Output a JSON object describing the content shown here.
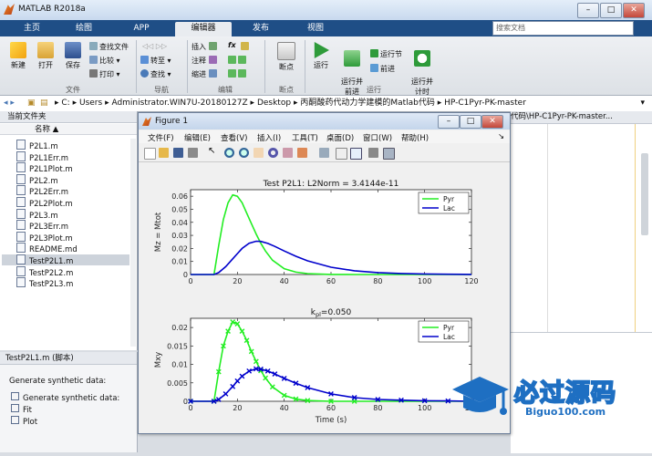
{
  "window": {
    "title": "MATLAB R2018a",
    "controls": [
      "–",
      "□",
      "✕"
    ]
  },
  "tabs": [
    {
      "label": "主页",
      "active": false
    },
    {
      "label": "绘图",
      "active": false
    },
    {
      "label": "APP",
      "active": false
    },
    {
      "label": "编辑器",
      "active": true
    },
    {
      "label": "发布",
      "active": false
    },
    {
      "label": "视图",
      "active": false
    }
  ],
  "search": {
    "placeholder": "搜索文档"
  },
  "ribbon": {
    "file": {
      "new": "新建",
      "open": "打开",
      "save": "保存",
      "find_files": "查找文件",
      "compare": "比较",
      "print": "打印",
      "group": "文件"
    },
    "nav": {
      "goto": "转至",
      "find": "查找",
      "group": "导航"
    },
    "edit": {
      "insert": "插入",
      "comment": "注释",
      "indent": "缩进",
      "fx": "fx",
      "group": "编辑"
    },
    "breakpoint": {
      "label": "断点",
      "group": "断点"
    },
    "run": {
      "run": "运行",
      "run_advance": "运行并\n前进",
      "run_section": "运行节",
      "advance": "前进",
      "run_time": "运行并\n计时",
      "group": "运行"
    }
  },
  "path": [
    "C:",
    "Users",
    "Administrator.WIN7U-20180127Z",
    "Desktop",
    "丙酮酸药代动力学建模的Matlab代码",
    "HP-C1Pyr-PK-master"
  ],
  "left_panel": {
    "title": "当前文件夹",
    "column": "名称 ▲",
    "files": [
      {
        "name": "P2L1.m",
        "selected": false
      },
      {
        "name": "P2L1Err.m",
        "selected": false
      },
      {
        "name": "P2L1Plot.m",
        "selected": false
      },
      {
        "name": "P2L2.m",
        "selected": false
      },
      {
        "name": "P2L2Err.m",
        "selected": false
      },
      {
        "name": "P2L2Plot.m",
        "selected": false
      },
      {
        "name": "P2L3.m",
        "selected": false
      },
      {
        "name": "P2L3Err.m",
        "selected": false
      },
      {
        "name": "P2L3Plot.m",
        "selected": false
      },
      {
        "name": "README.md",
        "selected": false
      },
      {
        "name": "TestP2L1.m",
        "selected": true
      },
      {
        "name": "TestP2L2.m",
        "selected": false
      },
      {
        "name": "TestP2L3.m",
        "selected": false
      }
    ]
  },
  "details": {
    "title": "TestP2L1.m  (脚本)",
    "heading": "Generate synthetic data:",
    "items": [
      "Generate synthetic data:",
      "Fit",
      "Plot"
    ]
  },
  "editor": {
    "tab_path": "代码\\HP-C1Pyr-PK-master..."
  },
  "figure": {
    "title": "Figure 1",
    "menu": [
      "文件(F)",
      "编辑(E)",
      "查看(V)",
      "插入(I)",
      "工具(T)",
      "桌面(D)",
      "窗口(W)",
      "帮助(H)"
    ]
  },
  "watermark": {
    "text": "必过源码",
    "url": "Biguo100.com"
  },
  "colors": {
    "pyr": "#22ee22",
    "lac": "#0000cc",
    "tabbar": "#1f4e86"
  },
  "chart_data": [
    {
      "type": "line",
      "title": "Test P2L1: L2Norm = 3.4144e-11",
      "xlabel": "",
      "ylabel": "Mz = Mtot",
      "xlim": [
        0,
        120
      ],
      "ylim": [
        0,
        0.065
      ],
      "xticks": [
        0,
        20,
        40,
        60,
        80,
        100,
        120
      ],
      "yticks": [
        0,
        0.01,
        0.02,
        0.03,
        0.04,
        0.05,
        0.06
      ],
      "ytick_labels": [
        "0",
        "0.01",
        "0.02",
        "0.03",
        "0.04",
        "0.05",
        "0.06"
      ],
      "legend": "top-right",
      "series": [
        {
          "name": "Pyr",
          "color": "#22ee22",
          "x": [
            0,
            10,
            12,
            14,
            16,
            18,
            20,
            22,
            24,
            26,
            28,
            30,
            32,
            35,
            40,
            45,
            50,
            60,
            70,
            120
          ],
          "y": [
            0,
            0,
            0.022,
            0.042,
            0.055,
            0.061,
            0.06,
            0.055,
            0.047,
            0.039,
            0.031,
            0.024,
            0.018,
            0.011,
            0.0045,
            0.0018,
            0.0007,
            0.0001,
            0,
            0
          ]
        },
        {
          "name": "Lac",
          "color": "#0000cc",
          "x": [
            0,
            10,
            12,
            15,
            18,
            20,
            22,
            25,
            28,
            30,
            33,
            36,
            40,
            45,
            50,
            60,
            70,
            80,
            90,
            100,
            110,
            120
          ],
          "y": [
            0,
            0,
            0.0015,
            0.006,
            0.012,
            0.016,
            0.02,
            0.024,
            0.0255,
            0.0254,
            0.0238,
            0.0215,
            0.018,
            0.014,
            0.0105,
            0.0056,
            0.0029,
            0.0015,
            0.0008,
            0.0004,
            0.0002,
            0.0001
          ]
        }
      ]
    },
    {
      "type": "line",
      "title": "k_pl=0.050",
      "title_main": "k",
      "title_sub": "pl",
      "title_rest": "=0.050",
      "xlabel": "Time (s)",
      "ylabel": "Mxy",
      "xlim": [
        0,
        120
      ],
      "ylim": [
        0,
        0.0225
      ],
      "xticks": [
        0,
        20,
        40,
        60,
        80,
        100,
        120
      ],
      "yticks": [
        0,
        0.005,
        0.01,
        0.015,
        0.02
      ],
      "ytick_labels": [
        "0",
        "0.005",
        "0.01",
        "0.015",
        "0.02"
      ],
      "legend": "top-right",
      "series": [
        {
          "name": "Pyr",
          "color": "#22ee22",
          "markers": true,
          "x": [
            0,
            10,
            12,
            14,
            16,
            18,
            20,
            22,
            24,
            26,
            28,
            30,
            32,
            35,
            40,
            45,
            50,
            60,
            70,
            120
          ],
          "y": [
            0,
            0,
            0.008,
            0.015,
            0.019,
            0.0215,
            0.021,
            0.019,
            0.0165,
            0.0135,
            0.0108,
            0.0083,
            0.0063,
            0.0039,
            0.0016,
            0.0006,
            0.0002,
            0,
            0,
            0
          ]
        },
        {
          "name": "Lac",
          "color": "#0000cc",
          "markers": true,
          "x": [
            0,
            10,
            12,
            15,
            18,
            20,
            22,
            25,
            28,
            30,
            33,
            36,
            40,
            45,
            50,
            60,
            70,
            80,
            90,
            100,
            110,
            120
          ],
          "y": [
            0,
            0,
            0.0005,
            0.002,
            0.004,
            0.0055,
            0.0068,
            0.0082,
            0.0088,
            0.0087,
            0.0082,
            0.0074,
            0.0062,
            0.0049,
            0.0037,
            0.002,
            0.001,
            0.0005,
            0.0003,
            0.00015,
            0.0001,
            0
          ]
        }
      ]
    }
  ]
}
